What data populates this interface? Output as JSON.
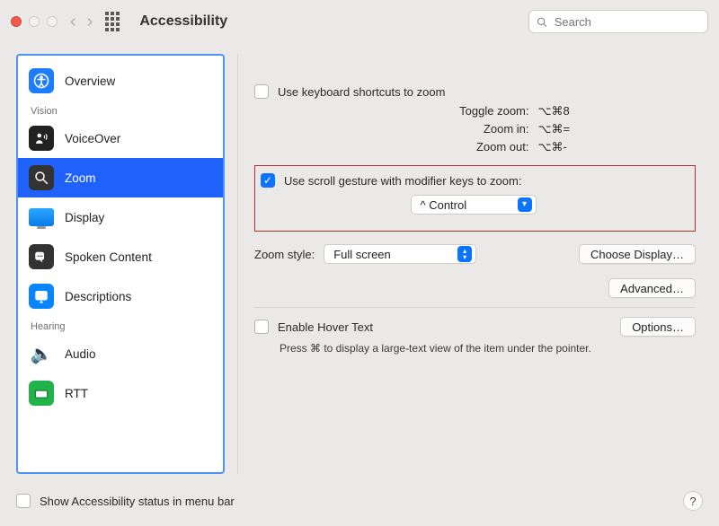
{
  "window": {
    "title": "Accessibility"
  },
  "search": {
    "placeholder": "Search"
  },
  "sidebar": {
    "items": [
      {
        "label": "Overview",
        "icon": "accessibility-icon"
      },
      {
        "label": "VoiceOver",
        "icon": "voiceover-icon"
      },
      {
        "label": "Zoom",
        "icon": "zoom-icon",
        "selected": true
      },
      {
        "label": "Display",
        "icon": "display-icon"
      },
      {
        "label": "Spoken Content",
        "icon": "spoken-content-icon"
      },
      {
        "label": "Descriptions",
        "icon": "descriptions-icon"
      },
      {
        "label": "Audio",
        "icon": "audio-icon"
      },
      {
        "label": "RTT",
        "icon": "rtt-icon"
      }
    ],
    "sections": {
      "vision": "Vision",
      "hearing": "Hearing"
    }
  },
  "panel": {
    "useKeyboardShortcuts": {
      "label": "Use keyboard shortcuts to zoom",
      "checked": false
    },
    "shortcuts": [
      {
        "k": "Toggle zoom:",
        "v": "⌥⌘8"
      },
      {
        "k": "Zoom in:",
        "v": "⌥⌘="
      },
      {
        "k": "Zoom out:",
        "v": "⌥⌘-"
      }
    ],
    "scrollGesture": {
      "label": "Use scroll gesture with modifier keys to zoom:",
      "checked": true,
      "modifierDisplay": "^ Control"
    },
    "zoomStyle": {
      "label": "Zoom style:",
      "value": "Full screen"
    },
    "chooseDisplay": "Choose Display…",
    "advanced": "Advanced…",
    "hoverText": {
      "label": "Enable Hover Text",
      "checked": false,
      "optionsLabel": "Options…"
    },
    "hoverHint": "Press ⌘ to display a large-text view of the item under the pointer."
  },
  "footer": {
    "showStatus": {
      "label": "Show Accessibility status in menu bar",
      "checked": false
    },
    "help": "?"
  }
}
